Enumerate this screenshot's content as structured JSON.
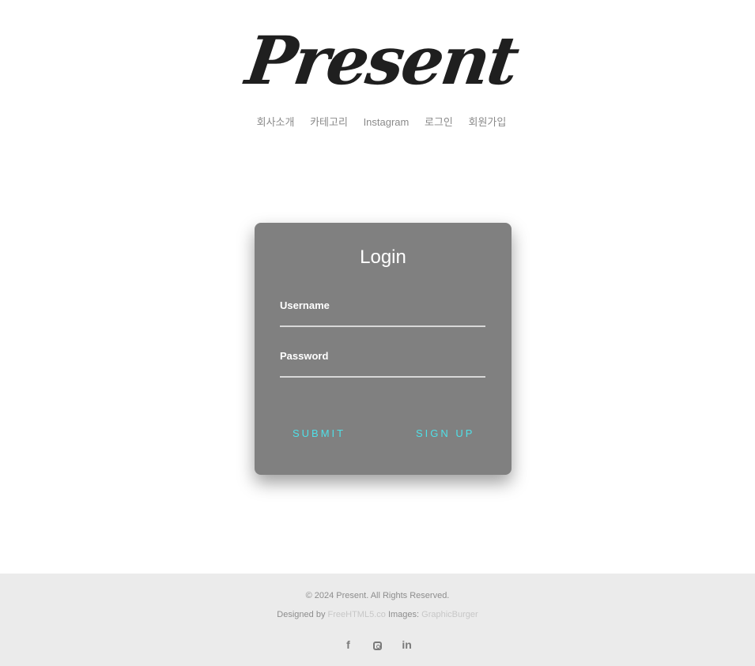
{
  "brand": {
    "logo_text": "Present"
  },
  "nav": {
    "items": [
      {
        "label": "회사소개"
      },
      {
        "label": "카테고리"
      },
      {
        "label": "Instagram"
      },
      {
        "label": "로그인"
      },
      {
        "label": "회원가입"
      }
    ]
  },
  "login": {
    "title": "Login",
    "username_label": "Username",
    "username_value": "",
    "password_label": "Password",
    "password_value": "",
    "submit_label": "SUBMIT",
    "signup_label": "SIGN UP"
  },
  "footer": {
    "copyright": "© 2024 Present. All Rights Reserved.",
    "designed_by_prefix": "Designed by",
    "designer_link": "FreeHTML5.co",
    "images_prefix": "Images:",
    "images_link": "GraphicBurger",
    "social": [
      {
        "icon": "facebook-icon",
        "glyph": "f"
      },
      {
        "icon": "instagram-icon",
        "glyph": ""
      },
      {
        "icon": "linkedin-icon",
        "glyph": "in"
      }
    ]
  },
  "colors": {
    "card_bg": "#808080",
    "button_accent": "#4fe0e8",
    "footer_bg": "#ebebeb"
  }
}
